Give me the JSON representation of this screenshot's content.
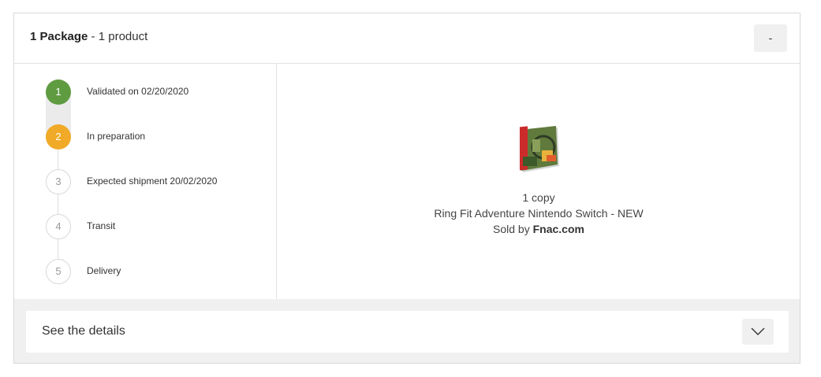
{
  "header": {
    "package_count": "1 Package",
    "separator": " - ",
    "product_count": "1 product",
    "collapse_label": "-"
  },
  "steps": [
    {
      "number": "1",
      "label": "Validated on 02/20/2020",
      "state": "done"
    },
    {
      "number": "2",
      "label": "In preparation",
      "state": "active"
    },
    {
      "number": "3",
      "label": "Expected shipment 20/02/2020",
      "state": "todo"
    },
    {
      "number": "4",
      "label": "Transit",
      "state": "todo"
    },
    {
      "number": "5",
      "label": "Delivery",
      "state": "todo"
    }
  ],
  "product": {
    "quantity": "1 copy",
    "name": "Ring Fit Adventure Nintendo Switch - NEW",
    "sold_by_prefix": "Sold by ",
    "seller": "Fnac.com",
    "image_icon": "product-box-image"
  },
  "details": {
    "label": "See the details",
    "icon": "chevron-down-icon"
  },
  "colors": {
    "done": "#5f9b41",
    "active": "#f0aa27",
    "todo_border": "#d8d8d8"
  }
}
